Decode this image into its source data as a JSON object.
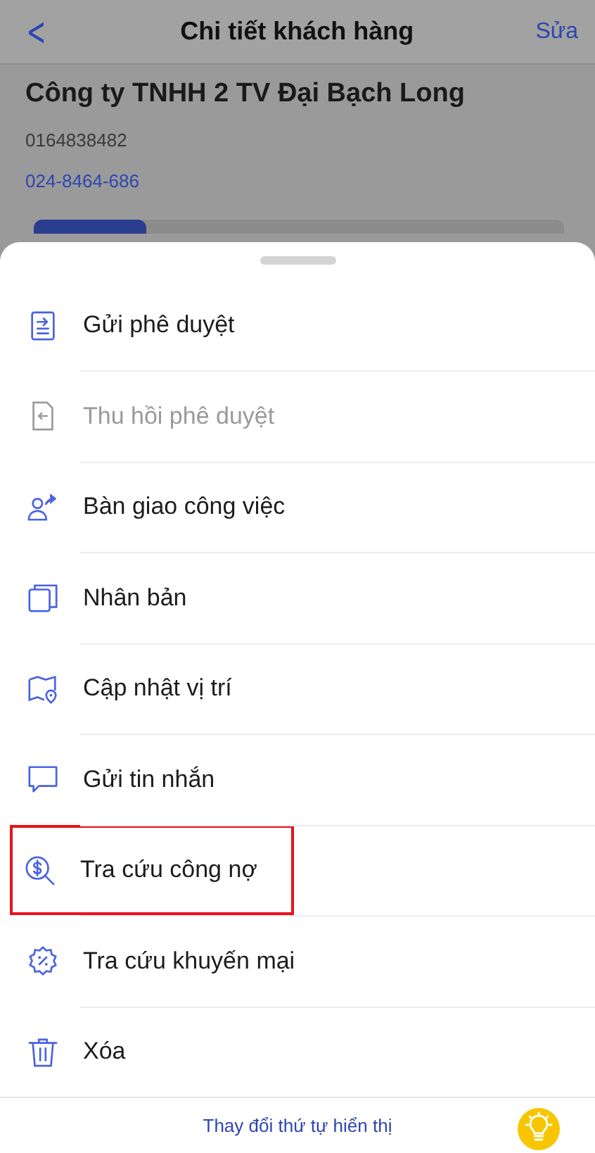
{
  "header": {
    "back": "<",
    "title": "Chi tiết khách hàng",
    "action": "Sửa"
  },
  "customer": {
    "name": "Công ty TNHH 2 TV Đại Bạch Long",
    "code": "0164838482",
    "phone": "024-8464-686"
  },
  "sheet": {
    "items": [
      {
        "kind": "send",
        "label": "Gửi phê duyệt",
        "disabled": false,
        "highlighted": false
      },
      {
        "kind": "recall",
        "label": "Thu hồi phê duyệt",
        "disabled": true,
        "highlighted": false
      },
      {
        "kind": "handover",
        "label": "Bàn giao công việc",
        "disabled": false,
        "highlighted": false
      },
      {
        "kind": "copy",
        "label": "Nhân bản",
        "disabled": false,
        "highlighted": false
      },
      {
        "kind": "location",
        "label": "Cập nhật vị trí",
        "disabled": false,
        "highlighted": false
      },
      {
        "kind": "message",
        "label": "Gửi tin nhắn",
        "disabled": false,
        "highlighted": false
      },
      {
        "kind": "debt",
        "label": "Tra cứu công nợ",
        "disabled": false,
        "highlighted": true
      },
      {
        "kind": "promo",
        "label": "Tra cứu khuyến mại",
        "disabled": false,
        "highlighted": false
      },
      {
        "kind": "delete",
        "label": "Xóa",
        "disabled": false,
        "highlighted": false
      }
    ],
    "footer": {
      "link": "Thay đổi thứ tự hiển thị"
    }
  }
}
